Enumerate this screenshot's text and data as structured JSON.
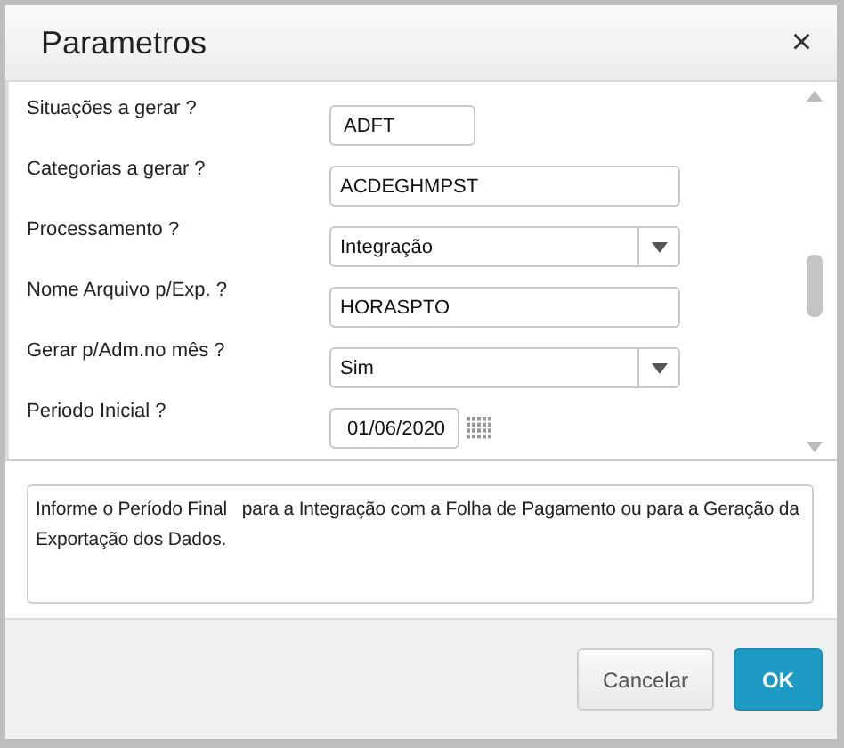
{
  "dialog": {
    "title": "Parametros",
    "close": "×"
  },
  "parameters": [
    {
      "label": "Situações a gerar ?",
      "kind": "short_text",
      "value": "ADFT"
    },
    {
      "label": "Categorias a gerar ?",
      "kind": "text",
      "value": "ACDEGHMPST"
    },
    {
      "label": "Processamento ?",
      "kind": "select",
      "value": "Integração"
    },
    {
      "label": "Nome Arquivo p/Exp. ?",
      "kind": "text",
      "value": "HORASPTO"
    },
    {
      "label": "Gerar p/Adm.no mês ?",
      "kind": "select",
      "value": "Sim"
    },
    {
      "label": "Periodo Inicial ?",
      "kind": "date",
      "value": "01/06/2020"
    }
  ],
  "help": "Informe o Período Final   para a Integração com a Folha de Pagamento ou para a Geração da Exportação dos Dados.",
  "buttons": [
    {
      "label": "Cancelar",
      "kind": "secondary"
    },
    {
      "label": "OK",
      "kind": "primary"
    }
  ]
}
